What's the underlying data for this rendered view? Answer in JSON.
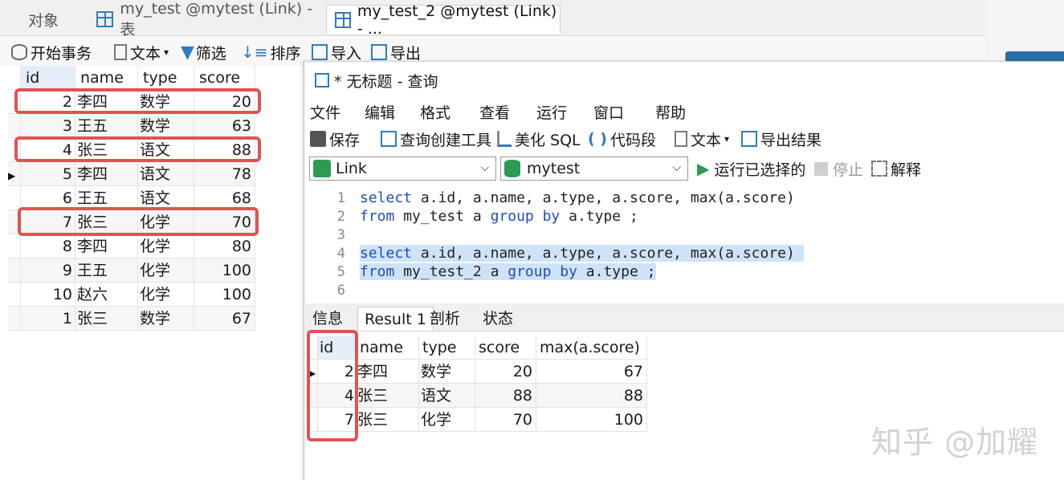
{
  "tabs": [
    {
      "label": "对象"
    },
    {
      "label": "my_test @mytest (Link) - 表"
    },
    {
      "label": "my_test_2 @mytest (Link) - ..."
    }
  ],
  "toolbar": {
    "begin_tx": "开始事务",
    "text": "文本",
    "filter": "筛选",
    "sort": "排序",
    "import": "导入",
    "export": "导出"
  },
  "left_table": {
    "columns": [
      "id",
      "name",
      "type",
      "score"
    ],
    "rows": [
      {
        "id": "2",
        "name": "李四",
        "type": "数学",
        "score": "20"
      },
      {
        "id": "3",
        "name": "王五",
        "type": "数学",
        "score": "63"
      },
      {
        "id": "4",
        "name": "张三",
        "type": "语文",
        "score": "88"
      },
      {
        "id": "5",
        "name": "李四",
        "type": "语文",
        "score": "78"
      },
      {
        "id": "6",
        "name": "王五",
        "type": "语文",
        "score": "68"
      },
      {
        "id": "7",
        "name": "张三",
        "type": "化学",
        "score": "70"
      },
      {
        "id": "8",
        "name": "李四",
        "type": "化学",
        "score": "80"
      },
      {
        "id": "9",
        "name": "王五",
        "type": "化学",
        "score": "100"
      },
      {
        "id": "10",
        "name": "赵六",
        "type": "化学",
        "score": "100"
      },
      {
        "id": "1",
        "name": "张三",
        "type": "数学",
        "score": "67"
      }
    ]
  },
  "query": {
    "title": "* 无标题 - 查询",
    "menu": [
      "文件",
      "编辑",
      "格式",
      "查看",
      "运行",
      "窗口",
      "帮助"
    ],
    "toolbar": {
      "save": "保存",
      "builder": "查询创建工具",
      "beautify": "美化 SQL",
      "snippet": "代码段",
      "text": "文本",
      "export_result": "导出结果"
    },
    "connection": "Link",
    "database": "mytest",
    "run_selected": "运行已选择的",
    "stop": "停止",
    "explain": "解释",
    "code": [
      {
        "n": "1",
        "kw1": "select",
        "t1": " a.id, a.name, a.type, a.score, max(a.score)"
      },
      {
        "n": "2",
        "kw1": "from",
        "t1": " my_test a ",
        "kw2": "group by",
        "t2": " a.type ;"
      },
      {
        "n": "3"
      },
      {
        "n": "4",
        "kw1": "select",
        "t1": " a.id, a.name, a.type, a.score, max(a.score) "
      },
      {
        "n": "5",
        "kw1": "from",
        "t1": " my_test_2 a ",
        "kw2": "group by",
        "t2": " a.type ;"
      },
      {
        "n": "6"
      }
    ]
  },
  "result_tabs": [
    "信息",
    "Result 1",
    "剖析",
    "状态"
  ],
  "result_table": {
    "columns": [
      "id",
      "name",
      "type",
      "score",
      "max(a.score)"
    ],
    "rows": [
      {
        "id": "2",
        "name": "李四",
        "type": "数学",
        "score": "20",
        "max": "67"
      },
      {
        "id": "4",
        "name": "张三",
        "type": "语文",
        "score": "88",
        "max": "88"
      },
      {
        "id": "7",
        "name": "张三",
        "type": "化学",
        "score": "70",
        "max": "100"
      }
    ]
  },
  "watermark": "知乎 @加耀",
  "colors": {
    "highlight_box": "#e05353",
    "keyword": "#1f4fb5",
    "selection": "#cfe3f8"
  }
}
